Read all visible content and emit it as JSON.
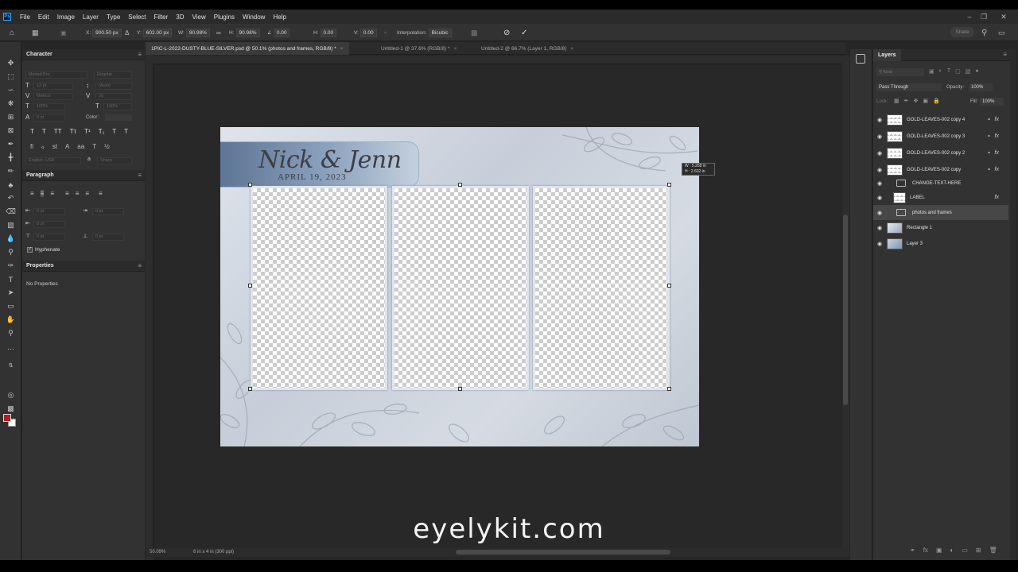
{
  "menubar": {
    "items": [
      "File",
      "Edit",
      "Image",
      "Layer",
      "Type",
      "Select",
      "Filter",
      "3D",
      "View",
      "Plugins",
      "Window",
      "Help"
    ]
  },
  "options": {
    "x_label": "X:",
    "x_value": "900.50 px",
    "y_label": "Y:",
    "y_value": "602.00 px",
    "w_label": "W:",
    "w_value": "90.98%",
    "h_label": "H:",
    "h_value": "90.98%",
    "angle_value": "0.00",
    "hskew_label": "H:",
    "hskew_value": "0.00",
    "vskew_label": "V:",
    "vskew_value": "0.00",
    "interp_label": "Interpolation:",
    "interp_value": "Bicubic",
    "share_label": "Share"
  },
  "tabs": [
    {
      "label": "1PIC-L-2022-DUSTY-BLUE-SILVER.psd @ 50.1% (photos and frames, RGB/8) *"
    },
    {
      "label": "Untitled-1 @ 37.6% (RGB/8) *"
    },
    {
      "label": "Untitled-2 @ 66.7% (Layer 1, RGB/8)"
    }
  ],
  "character": {
    "title": "Character",
    "font_family": "Myriad Pro",
    "font_style": "Regular",
    "size": "12 pt",
    "leading": "(Auto)",
    "kerning": "Metrics",
    "tracking": "20",
    "vscale": "100%",
    "hscale": "100%",
    "baseline": "0 pt",
    "color_label": "Color:",
    "language": "English: USA",
    "aa": "Sharp"
  },
  "paragraph": {
    "title": "Paragraph",
    "indent_left": "0 pt",
    "indent_right": "0 pt",
    "first_line": "0 pt",
    "space_before": "0 pt",
    "space_after": "0 pt",
    "hyphenate_label": "Hyphenate"
  },
  "properties": {
    "title": "Properties",
    "empty_text": "No Properties"
  },
  "document": {
    "title_script": "Nick & Jenn",
    "title_date": "APRIL 19, 2023",
    "transform_tip_w": "W : 5.268 in",
    "transform_tip_h": "H : 2.602 in"
  },
  "status": {
    "zoom": "50.09%",
    "doc_info": "6 in x 4 in (300 ppi)"
  },
  "watermark": "eyelykit.com",
  "layers": {
    "title": "Layers",
    "search_placeholder": "Kind",
    "blend_mode": "Pass Through",
    "opacity_label": "Opacity:",
    "opacity_value": "100%",
    "lock_label": "Lock:",
    "fill_label": "Fill:",
    "fill_value": "100%",
    "items": [
      {
        "name": "GOLD-LEAVES-002 copy 4",
        "fx": "fx"
      },
      {
        "name": "GOLD-LEAVES-002 copy 3",
        "fx": "fx"
      },
      {
        "name": "GOLD-LEAVES-002 copy 2",
        "fx": "fx"
      },
      {
        "name": "GOLD-LEAVES-002 copy",
        "fx": "fx"
      },
      {
        "name": "CHANGE-TEXT-HERE"
      },
      {
        "name": "LABEL",
        "fx": "fx"
      },
      {
        "name": "photos and frames"
      },
      {
        "name": "Rectangle 1"
      },
      {
        "name": "Layer 3"
      }
    ]
  }
}
